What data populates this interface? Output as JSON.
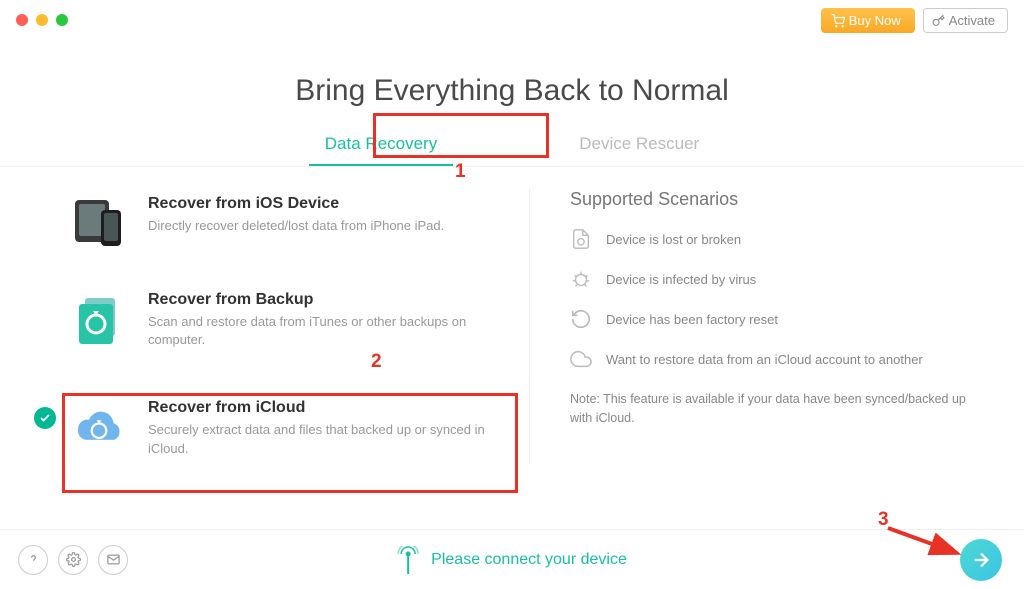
{
  "header": {
    "buy_label": "Buy Now",
    "activate_label": "Activate"
  },
  "title": "Bring Everything Back to Normal",
  "tabs": {
    "recovery": "Data Recovery",
    "rescuer": "Device Rescuer"
  },
  "options": {
    "ios": {
      "title": "Recover from iOS Device",
      "desc": "Directly recover deleted/lost data from iPhone iPad."
    },
    "backup": {
      "title": "Recover from Backup",
      "desc": "Scan and restore data from iTunes or other backups on computer."
    },
    "icloud": {
      "title": "Recover from iCloud",
      "desc": "Securely extract data and files that backed up or synced in iCloud."
    }
  },
  "scenarios": {
    "title": "Supported Scenarios",
    "items": [
      "Device is lost or broken",
      "Device is infected by virus",
      "Device has been factory reset",
      "Want to restore data from an iCloud account to another"
    ],
    "note": "Note: This feature is available if your data have been synced/backed up with iCloud."
  },
  "footer": {
    "connect_msg": "Please connect your device"
  },
  "annotations": {
    "n1": "1",
    "n2": "2",
    "n3": "3"
  }
}
